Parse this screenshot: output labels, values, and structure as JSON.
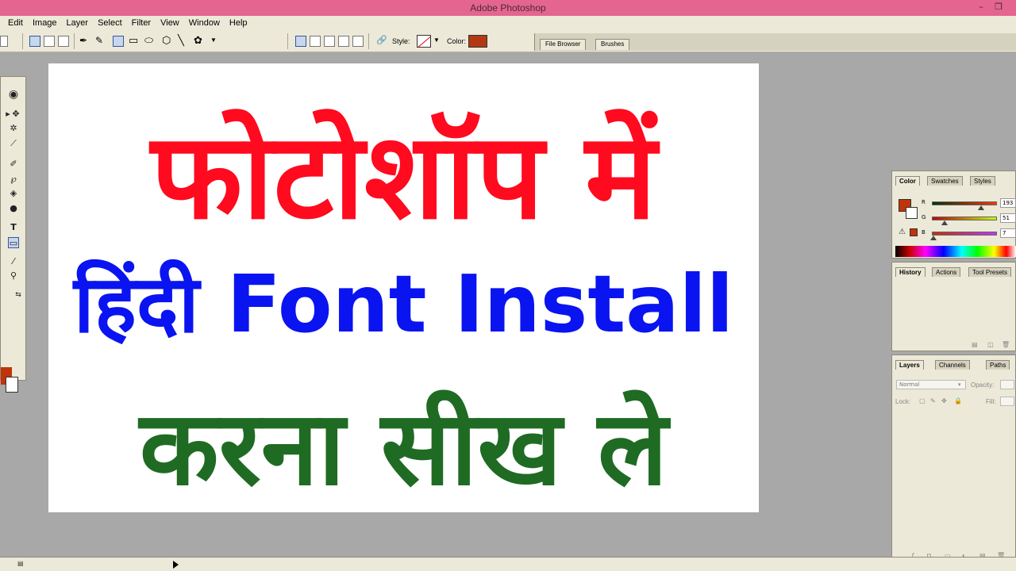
{
  "window": {
    "title": "Adobe Photoshop"
  },
  "menu": [
    "Edit",
    "Image",
    "Layer",
    "Select",
    "Filter",
    "View",
    "Window",
    "Help"
  ],
  "options_bar": {
    "style_label": "Style:",
    "color_label": "Color:",
    "color": "#b23a12"
  },
  "palette_well": {
    "tabs": [
      "File Browser",
      "Brushes"
    ]
  },
  "canvas": {
    "line1": {
      "text": "फोटोशॉप में",
      "color": "#ff0a1e"
    },
    "line2": {
      "text": "हिंदी Font Install",
      "color": "#0a14f0"
    },
    "line3": {
      "text": "करना सीख ले",
      "color": "#1f6b23"
    }
  },
  "color_palette": {
    "tabs": [
      "Color",
      "Swatches",
      "Styles"
    ],
    "foreground": "#c1330a",
    "channels": [
      {
        "label": "R",
        "value": "193",
        "level": 0.757,
        "gradient": "linear-gradient(to right,#003307,#ff3307)"
      },
      {
        "label": "G",
        "value": "51",
        "level": 0.2,
        "gradient": "linear-gradient(to right,#c10007,#c1ff07)"
      },
      {
        "label": "B",
        "value": "7",
        "level": 0.027,
        "gradient": "linear-gradient(to right,#c13300,#c133ff)"
      }
    ]
  },
  "history_palette": {
    "tabs": [
      "History",
      "Actions",
      "Tool Presets"
    ]
  },
  "layers_palette": {
    "tabs": [
      "Layers",
      "Channels",
      "Paths"
    ],
    "blend_mode": "Normal",
    "opacity_label": "Opacity:",
    "lock_label": "Lock:",
    "fill_label": "Fill:"
  }
}
